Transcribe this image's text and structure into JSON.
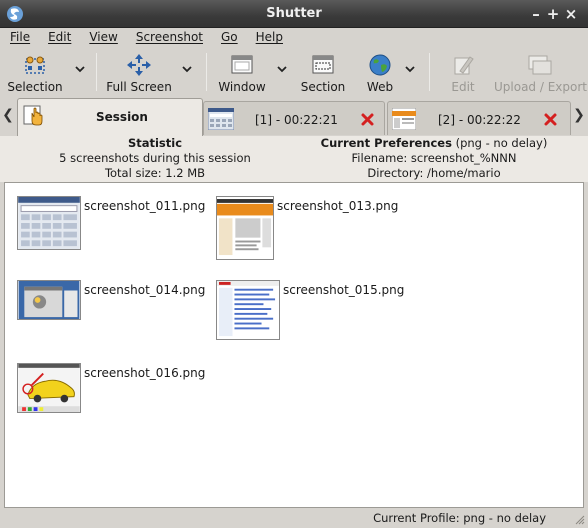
{
  "window": {
    "title": "Shutter",
    "minimize": "–",
    "maximize": "+",
    "close": "×"
  },
  "menubar": {
    "items": [
      "File",
      "Edit",
      "View",
      "Screenshot",
      "Go",
      "Help"
    ]
  },
  "toolbar": {
    "selection": "Selection",
    "full_screen": "Full Screen",
    "window": "Window",
    "section": "Section",
    "web": "Web",
    "edit": "Edit",
    "upload_export": "Upload / Export"
  },
  "tabs": [
    {
      "label": "Session",
      "active": true
    },
    {
      "label": "[1] - 00:22:21",
      "active": false
    },
    {
      "label": "[2] - 00:22:22",
      "active": false
    }
  ],
  "statistic": {
    "heading": "Statistic",
    "line1": "5 screenshots during this session",
    "line2": "Total size: 1.2 MB"
  },
  "preferences": {
    "heading": "Current Preferences",
    "heading_suffix": " (png - no delay)",
    "filename": "Filename: screenshot_%NNN",
    "directory": "Directory: /home/mario"
  },
  "screenshots": [
    {
      "name": "screenshot_011.png"
    },
    {
      "name": "screenshot_013.png"
    },
    {
      "name": "screenshot_014.png"
    },
    {
      "name": "screenshot_015.png"
    },
    {
      "name": "screenshot_016.png"
    }
  ],
  "statusbar": {
    "text": "Current Profile: png - no delay"
  },
  "colors": {
    "close_red": "#d42020",
    "chrome": "#d6d3ce",
    "titlebar": "#3a3a3a"
  }
}
